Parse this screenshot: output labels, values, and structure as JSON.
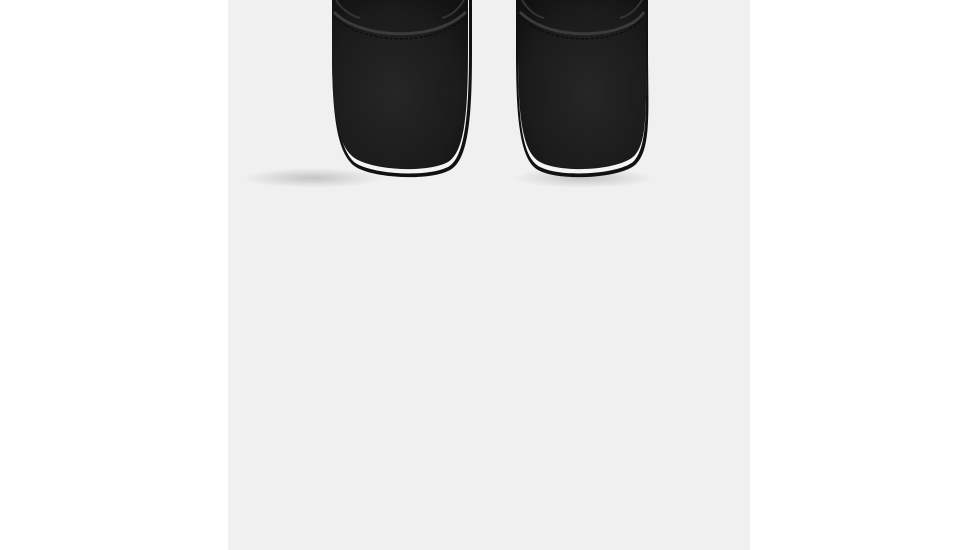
{
  "viewer": {
    "image_subject": "boots-top-view-icon",
    "panel_color": "#f0f0f0",
    "page_color": "#ffffff",
    "boot_color": "#1c1c1c",
    "sole_color": "#f4f4f4"
  }
}
